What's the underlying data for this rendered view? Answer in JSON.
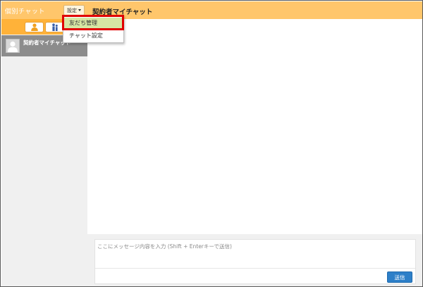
{
  "sidebar": {
    "title": "個別チャット",
    "settings_label": "設定",
    "tabs": [
      {
        "name": "person-icon",
        "active": true
      },
      {
        "name": "group-icon",
        "active": false
      }
    ],
    "chats": [
      {
        "name": "契約者マイチャット",
        "avatar": "user-silhouette-icon"
      }
    ]
  },
  "dropdown": {
    "items": [
      {
        "label": "友だち管理",
        "highlighted": true
      },
      {
        "label": "チャット設定",
        "highlighted": false
      }
    ]
  },
  "main": {
    "room_title": "契約者マイチャット",
    "input_placeholder": "ここにメッセージ内容を入力 (Shift + Enterキーで送信)",
    "send_label": "送信"
  },
  "colors": {
    "header": "#ffc66b",
    "tabbar": "#ffb239",
    "selected_chat": "#8c8c8c",
    "send_button": "#2d7fc8",
    "highlight_border": "#e00000",
    "menu_highlight": "#d6e6a4"
  }
}
